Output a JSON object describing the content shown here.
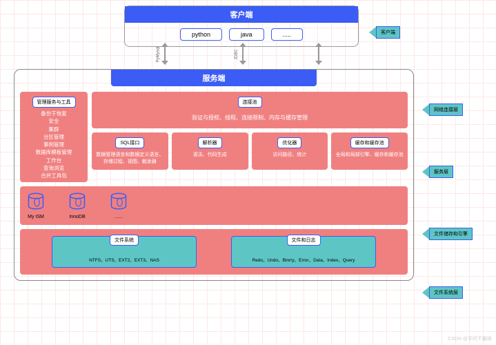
{
  "client": {
    "title": "客户端",
    "items": [
      "python",
      "java",
      "....."
    ]
  },
  "connectors": [
    "PyMysql",
    "JDBC",
    ""
  ],
  "server": {
    "title": "服务端",
    "mgmt": {
      "header": "管理服务与工具",
      "items": [
        "备份于恢复",
        "安全",
        "集群",
        "分区管理",
        "事例管理",
        "数据库模板管理",
        "工作台",
        "查询浏览",
        "合并工具包"
      ]
    },
    "pool": {
      "header": "连接池",
      "text": "验证与授权、线程、连接限制、内存与缓存管理"
    },
    "sql": [
      {
        "header": "SQL接口",
        "text": "数据管理语言和数据定义语言、存储过程、视图、触发器"
      },
      {
        "header": "解析器",
        "text": "语法、代码生成"
      },
      {
        "header": "优化器",
        "text": "访问路径、统计"
      },
      {
        "header": "缓存和缓存池",
        "text": "全局和局部引擎、缓存和缓存池"
      }
    ],
    "engines": [
      "My ISM",
      "InnoDB",
      "......"
    ],
    "fs": [
      {
        "header": "文件系统",
        "text": "NTFS、UTS、EXT2、EXT3、NAS"
      },
      {
        "header": "文件和日志",
        "text": "Redo、Undo、Binrry、Error、Data、Index、Query"
      }
    ]
  },
  "labels": [
    "客户端",
    "网络连接层",
    "服务层",
    "文件储存和引擎",
    "文件系统层"
  ],
  "watermark": "CSDN @平时不搬砖"
}
